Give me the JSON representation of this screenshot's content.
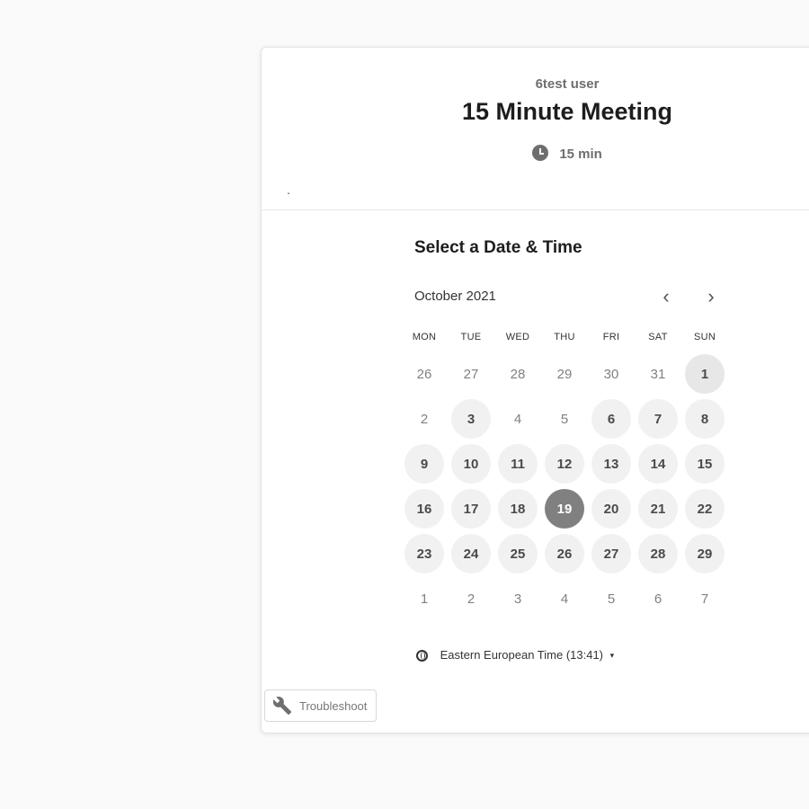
{
  "header": {
    "owner": "6test user",
    "event_title": "15 Minute Meeting",
    "duration": "15 min",
    "note": "."
  },
  "calendar": {
    "section_title": "Select a Date & Time",
    "month_label": "October 2021",
    "prev_icon": "‹",
    "next_icon": "›",
    "weekdays": [
      "MON",
      "TUE",
      "WED",
      "THU",
      "FRI",
      "SAT",
      "SUN"
    ],
    "days": [
      {
        "label": "26",
        "state": "outside"
      },
      {
        "label": "27",
        "state": "outside"
      },
      {
        "label": "28",
        "state": "outside"
      },
      {
        "label": "29",
        "state": "outside"
      },
      {
        "label": "30",
        "state": "outside"
      },
      {
        "label": "31",
        "state": "outside"
      },
      {
        "label": "1",
        "state": "available-first"
      },
      {
        "label": "2",
        "state": "unavailable"
      },
      {
        "label": "3",
        "state": "available"
      },
      {
        "label": "4",
        "state": "unavailable"
      },
      {
        "label": "5",
        "state": "unavailable"
      },
      {
        "label": "6",
        "state": "available"
      },
      {
        "label": "7",
        "state": "available"
      },
      {
        "label": "8",
        "state": "available"
      },
      {
        "label": "9",
        "state": "available"
      },
      {
        "label": "10",
        "state": "available"
      },
      {
        "label": "11",
        "state": "available"
      },
      {
        "label": "12",
        "state": "available"
      },
      {
        "label": "13",
        "state": "available"
      },
      {
        "label": "14",
        "state": "available"
      },
      {
        "label": "15",
        "state": "available"
      },
      {
        "label": "16",
        "state": "available"
      },
      {
        "label": "17",
        "state": "available"
      },
      {
        "label": "18",
        "state": "available"
      },
      {
        "label": "19",
        "state": "selected"
      },
      {
        "label": "20",
        "state": "available"
      },
      {
        "label": "21",
        "state": "available"
      },
      {
        "label": "22",
        "state": "available"
      },
      {
        "label": "23",
        "state": "available"
      },
      {
        "label": "24",
        "state": "available"
      },
      {
        "label": "25",
        "state": "available"
      },
      {
        "label": "26",
        "state": "available"
      },
      {
        "label": "27",
        "state": "available"
      },
      {
        "label": "28",
        "state": "available"
      },
      {
        "label": "29",
        "state": "available"
      },
      {
        "label": "1",
        "state": "outside"
      },
      {
        "label": "2",
        "state": "outside"
      },
      {
        "label": "3",
        "state": "outside"
      },
      {
        "label": "4",
        "state": "outside"
      },
      {
        "label": "5",
        "state": "outside"
      },
      {
        "label": "6",
        "state": "outside"
      },
      {
        "label": "7",
        "state": "outside"
      }
    ]
  },
  "timezone": {
    "label": "Eastern European Time (13:41)",
    "caret": "▾"
  },
  "footer": {
    "troubleshoot_label": "Troubleshoot"
  },
  "colors": {
    "selected": "#808080",
    "available_bg": "#f1f1f1",
    "corner": "#5f5f5f"
  }
}
